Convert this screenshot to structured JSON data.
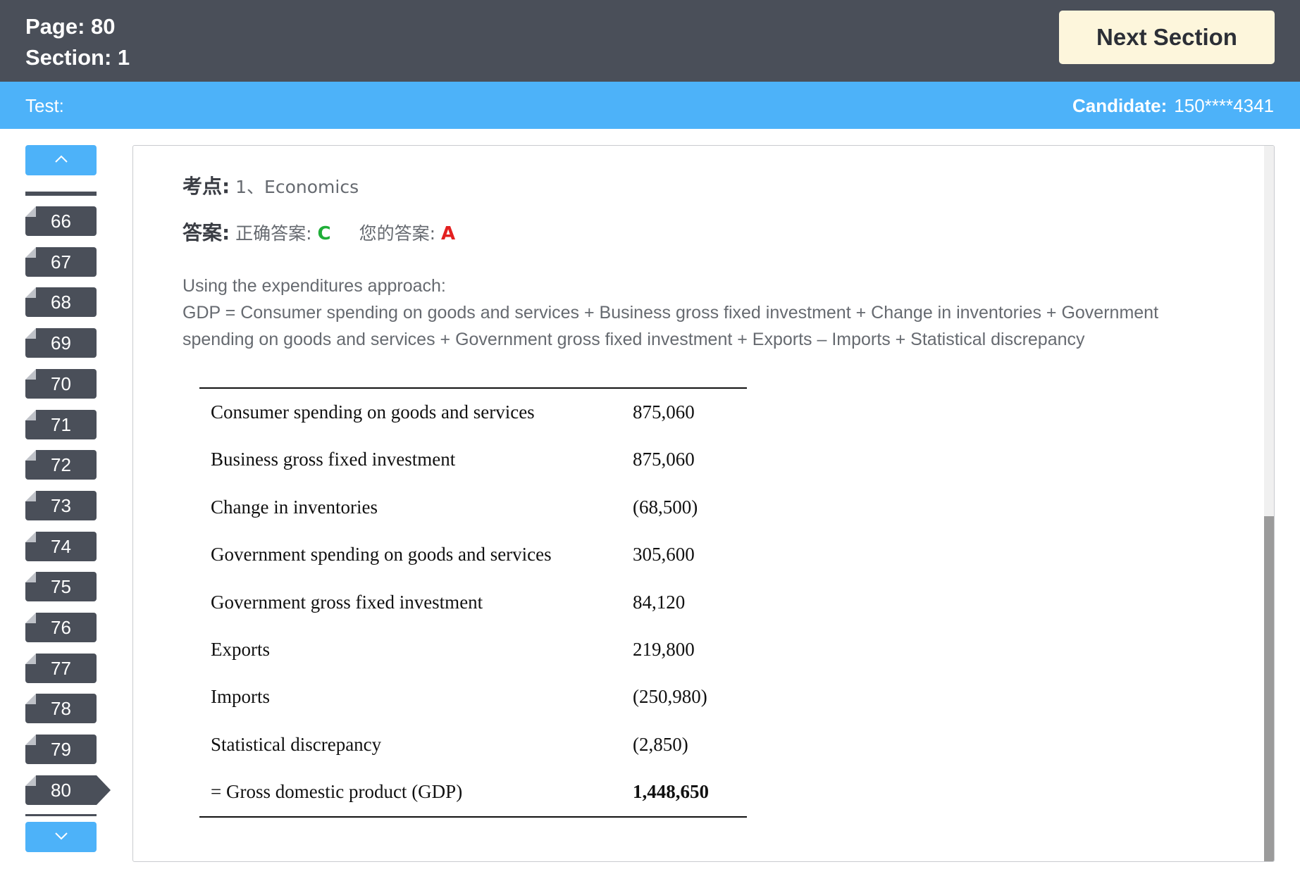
{
  "header": {
    "page_label": "Page: 80",
    "section_label": "Section: 1",
    "next_button": "Next Section"
  },
  "subheader": {
    "test_label": "Test:",
    "candidate_label": "Candidate:",
    "candidate_id": "150****4341"
  },
  "sidebar": {
    "up_icon": "chevron-up-icon",
    "down_icon": "chevron-down-icon",
    "questions": [
      {
        "number": "66"
      },
      {
        "number": "67"
      },
      {
        "number": "68"
      },
      {
        "number": "69"
      },
      {
        "number": "70"
      },
      {
        "number": "71"
      },
      {
        "number": "72"
      },
      {
        "number": "73"
      },
      {
        "number": "74"
      },
      {
        "number": "75"
      },
      {
        "number": "76"
      },
      {
        "number": "77"
      },
      {
        "number": "78"
      },
      {
        "number": "79"
      },
      {
        "number": "80"
      }
    ],
    "current": "80"
  },
  "content": {
    "topic_label": "考点:",
    "topic_value": "1、Economics",
    "answer_label": "答案:",
    "correct_label": "正确答案:",
    "correct_value": "C",
    "your_label": "您的答案:",
    "your_value": "A",
    "explanation_line1": "Using the expenditures approach:",
    "explanation_line2": "GDP = Consumer spending on goods and services + Business gross fixed investment + Change in inventories + Government spending on goods and services + Government gross fixed investment + Exports – Imports + Statistical discrepancy",
    "table": [
      {
        "item": "Consumer spending on goods and services",
        "amount": "875,060"
      },
      {
        "item": "Business gross fixed investment",
        "amount": "875,060"
      },
      {
        "item": "Change in inventories",
        "amount": "(68,500)"
      },
      {
        "item": "Government spending on goods and services",
        "amount": "305,600"
      },
      {
        "item": "Government gross fixed investment",
        "amount": "84,120"
      },
      {
        "item": "Exports",
        "amount": "219,800"
      },
      {
        "item": "Imports",
        "amount": "(250,980)"
      },
      {
        "item": "Statistical discrepancy",
        "amount": "(2,850)"
      },
      {
        "item": "= Gross domestic product (GDP)",
        "amount": "1,448,650"
      }
    ]
  },
  "colors": {
    "topbar": "#4a4f59",
    "subbar": "#4db2f9",
    "correct": "#1fae38",
    "wrong": "#e32020"
  }
}
